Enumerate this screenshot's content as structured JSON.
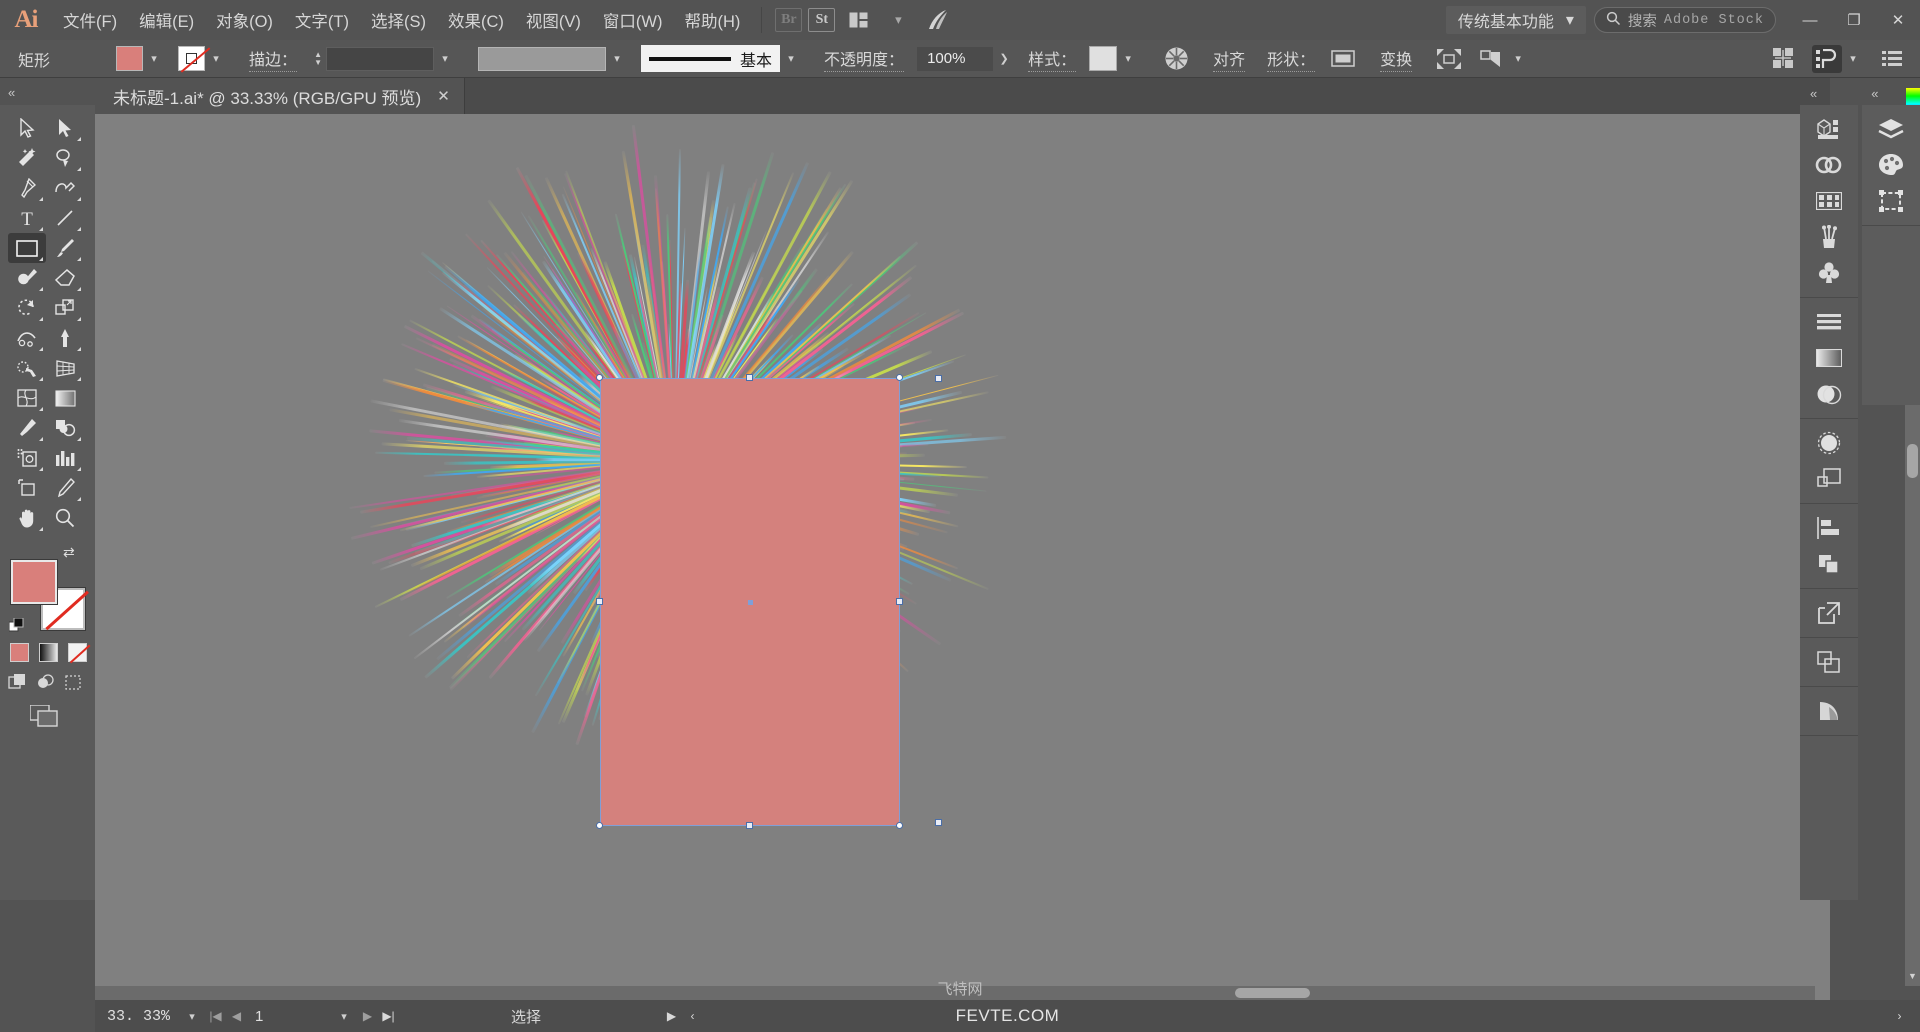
{
  "app": {
    "logo": "Ai",
    "menus": [
      {
        "label": "文件(F)",
        "name": "menu-file"
      },
      {
        "label": "编辑(E)",
        "name": "menu-edit"
      },
      {
        "label": "对象(O)",
        "name": "menu-object"
      },
      {
        "label": "文字(T)",
        "name": "menu-type"
      },
      {
        "label": "选择(S)",
        "name": "menu-select"
      },
      {
        "label": "效果(C)",
        "name": "menu-effect"
      },
      {
        "label": "视图(V)",
        "name": "menu-view"
      },
      {
        "label": "窗口(W)",
        "name": "menu-window"
      },
      {
        "label": "帮助(H)",
        "name": "menu-help"
      }
    ],
    "bridge_label": "Br",
    "stock_label": "St",
    "workspace": "传统基本功能",
    "search_placeholder_cn": "搜索",
    "search_placeholder_en": "Adobe Stock",
    "window_minimize": "—",
    "window_restore": "❐",
    "window_close": "✕"
  },
  "control_bar": {
    "object_type": "矩形",
    "fill_color": "#d97f7b",
    "stroke_color": "none",
    "stroke_label": "描边：",
    "stroke_weight": "",
    "brush_label": "基本",
    "opacity_label": "不透明度：",
    "opacity_value": "100%",
    "style_label": "样式：",
    "align_label": "对齐",
    "shape_label": "形状：",
    "transform_label": "变换",
    "icons": [
      "recolor-artwork-icon",
      "shape-properties-icon",
      "isolate-selected-icon",
      "select-similar-icon",
      "arrange-documents-icon",
      "preferences-icon",
      "menu-list-icon"
    ]
  },
  "document": {
    "tab_title": "未标题-1.ai* @ 33.33% (RGB/GPU 预览)",
    "tab_close": "✕"
  },
  "toolbar": {
    "collapse": "«",
    "tools": [
      {
        "name": "selection-tool",
        "label": "选择工具",
        "selected": false
      },
      {
        "name": "direct-selection-tool",
        "label": "直接选择工具",
        "selected": false
      },
      {
        "name": "magic-wand-tool",
        "label": "魔棒工具",
        "selected": false
      },
      {
        "name": "lasso-tool",
        "label": "套索工具",
        "selected": false
      },
      {
        "name": "pen-tool",
        "label": "钢笔工具",
        "selected": false
      },
      {
        "name": "curvature-tool",
        "label": "曲率工具",
        "selected": false
      },
      {
        "name": "type-tool",
        "label": "文字工具",
        "selected": false
      },
      {
        "name": "line-segment-tool",
        "label": "直线段工具",
        "selected": false
      },
      {
        "name": "rectangle-tool",
        "label": "矩形工具",
        "selected": true
      },
      {
        "name": "paintbrush-tool",
        "label": "画笔工具",
        "selected": false
      },
      {
        "name": "shaper-tool",
        "label": "Shaper 工具",
        "selected": false
      },
      {
        "name": "eraser-tool",
        "label": "橡皮擦工具",
        "selected": false
      },
      {
        "name": "rotate-tool",
        "label": "旋转工具",
        "selected": false
      },
      {
        "name": "scale-tool",
        "label": "比例缩放工具",
        "selected": false
      },
      {
        "name": "width-tool",
        "label": "宽度工具",
        "selected": false
      },
      {
        "name": "free-transform-tool",
        "label": "自由变换工具",
        "selected": false
      },
      {
        "name": "shape-builder-tool",
        "label": "形状生成器工具",
        "selected": false
      },
      {
        "name": "perspective-grid-tool",
        "label": "透视网格工具",
        "selected": false
      },
      {
        "name": "mesh-tool",
        "label": "网格工具",
        "selected": false
      },
      {
        "name": "gradient-tool",
        "label": "渐变工具",
        "selected": false
      },
      {
        "name": "eyedropper-tool",
        "label": "吸管工具",
        "selected": false
      },
      {
        "name": "blend-tool",
        "label": "混合工具",
        "selected": false
      },
      {
        "name": "symbol-sprayer-tool",
        "label": "符号喷枪工具",
        "selected": false
      },
      {
        "name": "column-graph-tool",
        "label": "柱形图工具",
        "selected": false
      },
      {
        "name": "artboard-tool",
        "label": "画板工具",
        "selected": false
      },
      {
        "name": "slice-tool",
        "label": "切片工具",
        "selected": false
      },
      {
        "name": "hand-tool",
        "label": "抓手工具",
        "selected": false
      },
      {
        "name": "zoom-tool",
        "label": "缩放工具",
        "selected": false
      }
    ],
    "fill_color": "#d97f7b",
    "stroke_color": "none",
    "swap_icon": "⇄",
    "default_icon": "▫",
    "mini_controls": [
      "color-swatch",
      "gradient-swatch",
      "none-swatch"
    ],
    "draw_modes": [
      "draw-normal",
      "draw-behind",
      "draw-inside"
    ],
    "screen_mode": "screen-mode-icon"
  },
  "canvas": {
    "background": "#808080",
    "artboard_fill": "#ffffff",
    "selected_shape_fill": "#d4817d",
    "selection_border": "#7f9fd8"
  },
  "status_bar": {
    "zoom": "33. 33%",
    "page": "1",
    "status_text": "选择",
    "first_icon": "|◀",
    "prev_icon": "◀",
    "next_icon": "▶",
    "last_icon": "▶|",
    "play_icon": "▶",
    "left_arrow": "‹",
    "right_arrow": "›"
  },
  "watermark": {
    "cn": "飞特网",
    "en": "FEVTE.COM"
  },
  "dock": {
    "collapse_left": "«",
    "collapse_right": "«",
    "column_left": [
      {
        "name": "3d-materials-icon",
        "group": 0
      },
      {
        "name": "creative-cloud-libraries-icon",
        "group": 0
      },
      {
        "name": "swatches-icon",
        "group": 0
      },
      {
        "name": "brushes-icon",
        "group": 0
      },
      {
        "name": "symbols-icon",
        "group": 0
      },
      {
        "name": "align-stroke-icon",
        "group": 1
      },
      {
        "name": "gradient-icon",
        "group": 1
      },
      {
        "name": "transparency-icon",
        "group": 1
      },
      {
        "name": "appearance-icon",
        "group": 2
      },
      {
        "name": "graphic-styles-icon",
        "group": 2
      },
      {
        "name": "align-panel-icon",
        "group": 3
      },
      {
        "name": "pathfinder-icon",
        "group": 3
      },
      {
        "name": "asset-export-icon",
        "group": 4
      },
      {
        "name": "artboards-icon",
        "group": 5
      },
      {
        "name": "document-info-icon",
        "group": 6
      }
    ],
    "column_right": [
      {
        "name": "layers-icon"
      },
      {
        "name": "color-icon"
      },
      {
        "name": "properties-icon"
      }
    ]
  },
  "chart_data": null
}
